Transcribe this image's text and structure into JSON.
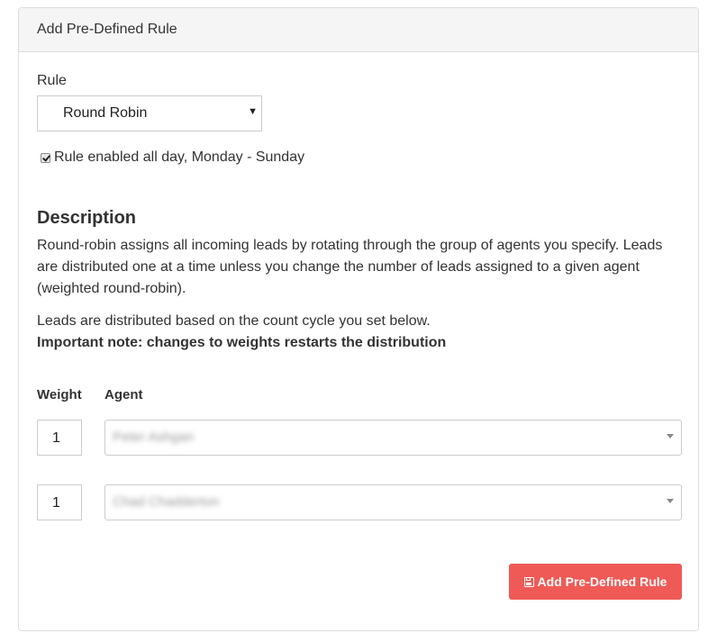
{
  "panel": {
    "title": "Add Pre-Defined Rule"
  },
  "rule": {
    "label": "Rule",
    "selected": "Round Robin",
    "caret_icon": "caret-down-icon"
  },
  "enabled": {
    "checked": true,
    "label": "Rule enabled all day, Monday - Sunday"
  },
  "description": {
    "title": "Description",
    "paragraph": "Round-robin assigns all incoming leads by rotating through the group of agents you specify. Leads are distributed one at a time unless you change the number of leads assigned to a given agent (weighted round-robin).",
    "count_cycle": "Leads are distributed based on the count cycle you set below.",
    "important": "Important note: changes to weights restarts the distribution"
  },
  "table": {
    "weight_header": "Weight",
    "agent_header": "Agent",
    "rows": [
      {
        "weight": "1",
        "agent": "Peter Ashgan"
      },
      {
        "weight": "1",
        "agent": "Chad Chadderton"
      }
    ]
  },
  "submit": {
    "icon": "save-icon",
    "label": "Add Pre-Defined Rule",
    "color": "#ef5a56"
  }
}
